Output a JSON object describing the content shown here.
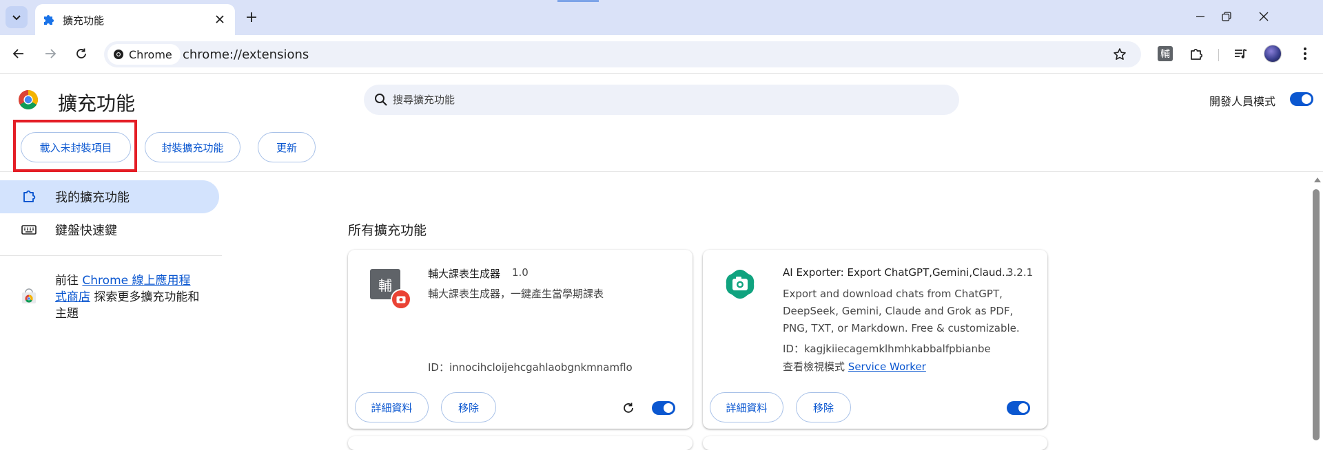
{
  "browser": {
    "tab_title": "擴充功能",
    "site_chip_label": "Chrome",
    "url": "chrome://extensions",
    "extension_badge_char": "輔"
  },
  "header": {
    "title": "擴充功能",
    "search_placeholder": "搜尋擴充功能",
    "dev_mode_label": "開發人員模式",
    "dev_mode_on": true,
    "buttons": {
      "load_unpacked": "載入未封裝項目",
      "pack": "封裝擴充功能",
      "update": "更新"
    }
  },
  "sidebar": {
    "items": [
      {
        "label": "我的擴充功能",
        "active": true
      },
      {
        "label": "鍵盤快速鍵",
        "active": false
      }
    ],
    "store": {
      "prefix": "前往 ",
      "link_text": "Chrome 線上應用程式商店",
      "suffix": " 探索更多擴充功能和主題"
    }
  },
  "main": {
    "section_title": "所有擴充功能",
    "extensions": [
      {
        "name": "輔大課表生成器",
        "version": "1.0",
        "description": "輔大課表生成器，一鍵產生當學期課表",
        "id": "ID：innocihcloijehcgahlaobgnkmnamflo",
        "details_label": "詳細資料",
        "remove_label": "移除",
        "enabled": true,
        "icon_char": "輔"
      },
      {
        "name": "AI Exporter: Export ChatGPT,Gemini,Claud...",
        "version": "3.2.1",
        "description": "Export and download chats from ChatGPT, DeepSeek, Gemini, Claude and Grok as PDF, PNG, TXT, or Markdown. Free & customizable.",
        "id": "ID：kagjkiiecagemklhmhkabbalfpbianbe",
        "inspect_label": "查看檢視模式",
        "inspect_link": "Service Worker",
        "details_label": "詳細資料",
        "remove_label": "移除",
        "enabled": true
      }
    ]
  },
  "colors": {
    "accent": "#0b57d0",
    "tabstrip": "#dae2f8",
    "highlight": "#e41e26"
  }
}
